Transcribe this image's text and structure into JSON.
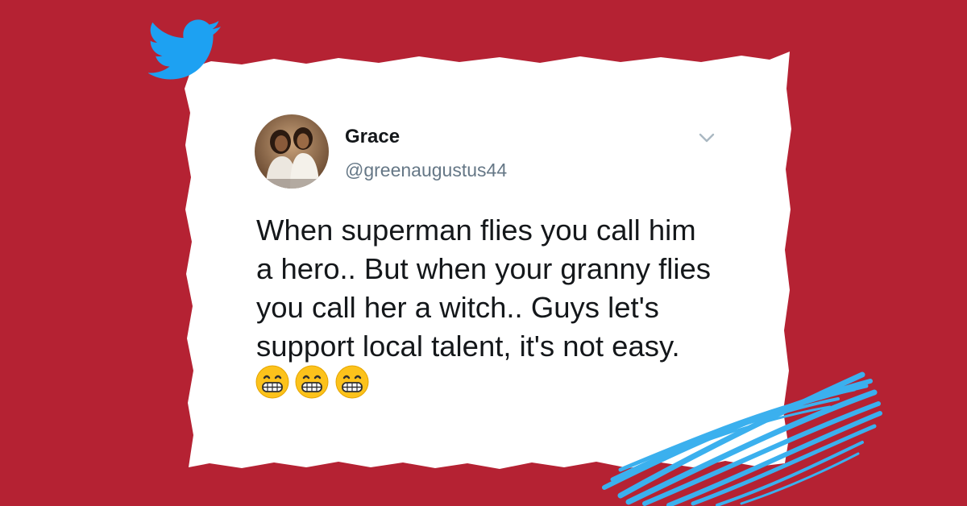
{
  "theme": {
    "background": "#b52233",
    "card": "#ffffff",
    "twitter_blue": "#1da1f2",
    "scribble_blue": "#3bb0ee",
    "text": "#14171a",
    "muted": "#657786"
  },
  "brand": {
    "icon": "twitter-bird-icon"
  },
  "tweet": {
    "author_name": "Grace",
    "author_handle": "@greenaugustus44",
    "avatar_icon": "profile-photo",
    "menu_icon": "chevron-down-icon",
    "text": "When superman flies you call him\na hero.. But when your granny flies\nyou call her a witch.. Guys let's\nsupport local talent, it's not easy.",
    "emojis": [
      "grinning-face-emoji",
      "grinning-face-emoji",
      "grinning-face-emoji"
    ]
  }
}
